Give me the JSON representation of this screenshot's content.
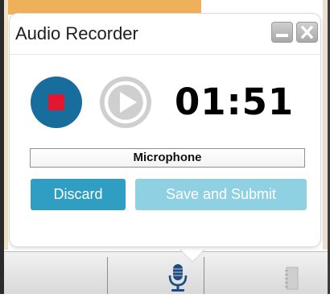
{
  "window": {
    "title": "Audio Recorder"
  },
  "title_bar_controls": {
    "minimize_icon": "minimize-icon",
    "close_icon": "close-icon"
  },
  "recorder": {
    "timer": "01:51",
    "stop_icon": "stop-icon",
    "play_icon": "play-icon",
    "input_source": "Microphone"
  },
  "actions": {
    "discard_label": "Discard",
    "save_label": "Save and Submit"
  },
  "toolbar": {
    "mic_icon": "microphone-icon",
    "notes_icon": "notes-icon"
  },
  "colors": {
    "stop_button": "#176d9c",
    "stop_square": "#e4152e",
    "play_button": "#cfcfcf",
    "discard_button": "#2f9ec2",
    "save_button_disabled": "#8fd0e2"
  }
}
